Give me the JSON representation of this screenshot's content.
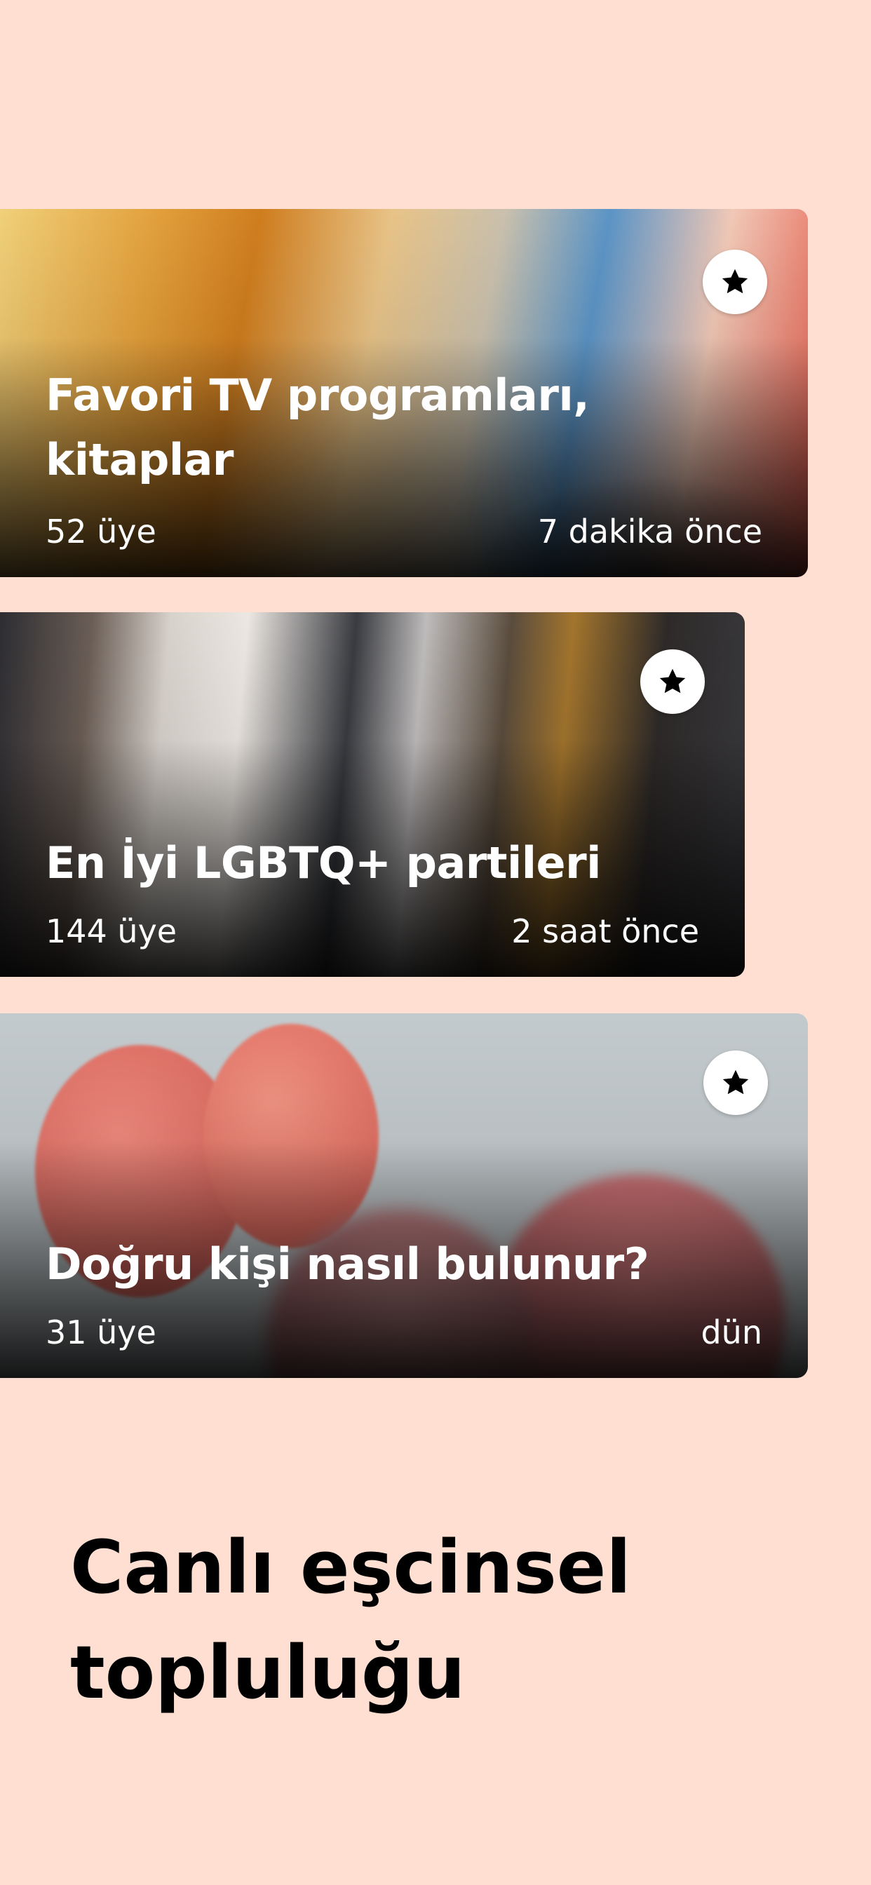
{
  "cards": [
    {
      "title_line1": "Favori TV programları,",
      "title_line2": "kitaplar",
      "members": "52 üye",
      "time": "7 dakika önce",
      "favorite_icon": "star-icon"
    },
    {
      "title_line1": "En İyi LGBTQ+ partileri",
      "members": "144 üye",
      "time": "2 saat önce",
      "favorite_icon": "star-icon"
    },
    {
      "title_line1": "Doğru kişi nasıl bulunur?",
      "members": "31 üye",
      "time": "dün",
      "favorite_icon": "star-icon"
    }
  ],
  "headline": {
    "line1": "Canlı eşcinsel",
    "line2": "topluluğu"
  },
  "colors": {
    "background": "#ffdfd2",
    "text_dark": "#000000",
    "text_light": "#ffffff"
  }
}
